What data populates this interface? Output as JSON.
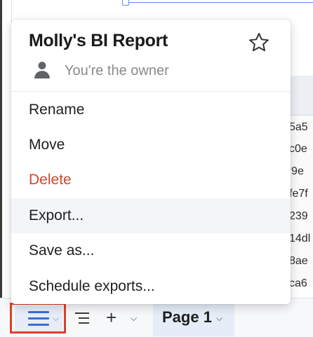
{
  "popup": {
    "title": "Molly's BI Report",
    "owner_text": "You're the owner",
    "items": [
      {
        "label": "Rename"
      },
      {
        "label": "Move"
      },
      {
        "label": "Delete"
      },
      {
        "label": "Export..."
      },
      {
        "label": "Save as..."
      },
      {
        "label": "Schedule exports..."
      }
    ]
  },
  "table": {
    "cells": [
      "5a5",
      "c0e",
      "'9e",
      "fe7f",
      "239",
      "14dl",
      "8ae",
      "ca6"
    ]
  },
  "bottom_bar": {
    "page_tab_label": "Page 1"
  },
  "colors": {
    "danger": "#d0492b",
    "accent": "#3a6fd0",
    "highlight_border": "#e0402a"
  },
  "icons": {
    "favorite": "star-icon",
    "owner": "person-icon",
    "menu": "hamburger-icon",
    "outline": "list-icon",
    "add": "plus-icon"
  }
}
